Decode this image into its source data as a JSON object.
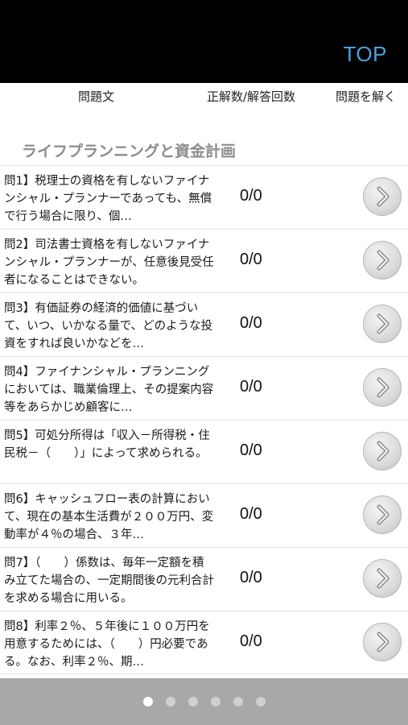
{
  "header": {
    "top_label": "TOP"
  },
  "columns": {
    "question": "問題文",
    "score": "正解数/解答回数",
    "solve": "問題を解く"
  },
  "section": {
    "title": "ライフプランニングと資金計画"
  },
  "questions": [
    {
      "text": "問1】税理士の資格を有しないファイナンシャル・プランナーであっても、無償で行う場合に限り、個…",
      "score": "0/0"
    },
    {
      "text": "問2】司法書士資格を有しないファイナンシャル・プランナーが、任意後見受任者になることはできない。",
      "score": "0/0"
    },
    {
      "text": "問3】有価証券の経済的価値に基づいて、いつ、いかなる量で、どのような投資をすれば良いかなどを…",
      "score": "0/0"
    },
    {
      "text": "問4】ファイナンシャル・プランニングにおいては、職業倫理上、その提案内容等をあらかじめ顧客に…",
      "score": "0/0"
    },
    {
      "text": "問5】可処分所得は「収入－所得税・住民税－（　　）」によって求められる。",
      "score": "0/0"
    },
    {
      "text": "問6】キャッシュフロー表の計算において、現在の基本生活費が２００万円、変動率が４％の場合、３年…",
      "score": "0/0"
    },
    {
      "text": "問7】（　　）係数は、毎年一定額を積み立てた場合の、一定期間後の元利合計を求める場合に用いる。",
      "score": "0/0"
    },
    {
      "text": "問8】利率２％、５年後に１００万円を用意するためには、（　　）円必要である。なお、利率２％、期…",
      "score": "0/0"
    }
  ],
  "pager": {
    "pages": 6,
    "current": 1
  }
}
